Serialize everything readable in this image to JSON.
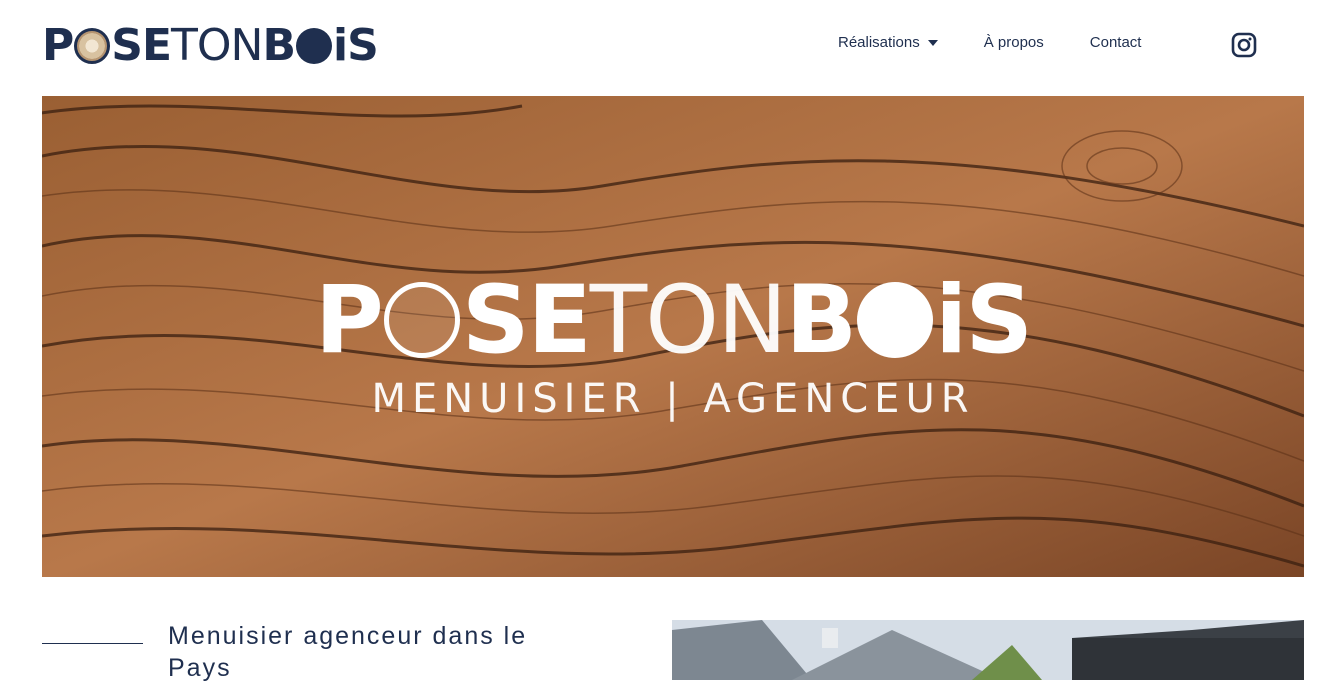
{
  "brand": {
    "logo_text_bold_1": "P",
    "logo_text_bold_2": "SE",
    "logo_text_light": "TON",
    "logo_text_bold_3": "B",
    "logo_text_bold_4": "iS"
  },
  "nav": {
    "items": [
      {
        "label": "Réalisations"
      },
      {
        "label": "À propos"
      },
      {
        "label": "Contact"
      }
    ],
    "instagram_icon": "instagram-icon"
  },
  "hero": {
    "title_bold_1": "P",
    "title_bold_2": "SE",
    "title_light": "TON",
    "title_bold_3": "B",
    "title_bold_4": "iS",
    "subtitle": "MENUISIER | AGENCEUR"
  },
  "intro": {
    "heading": "Menuisier agenceur dans le Pays"
  },
  "colors": {
    "navy": "#1f2f4f",
    "wood": "#8a5630"
  }
}
